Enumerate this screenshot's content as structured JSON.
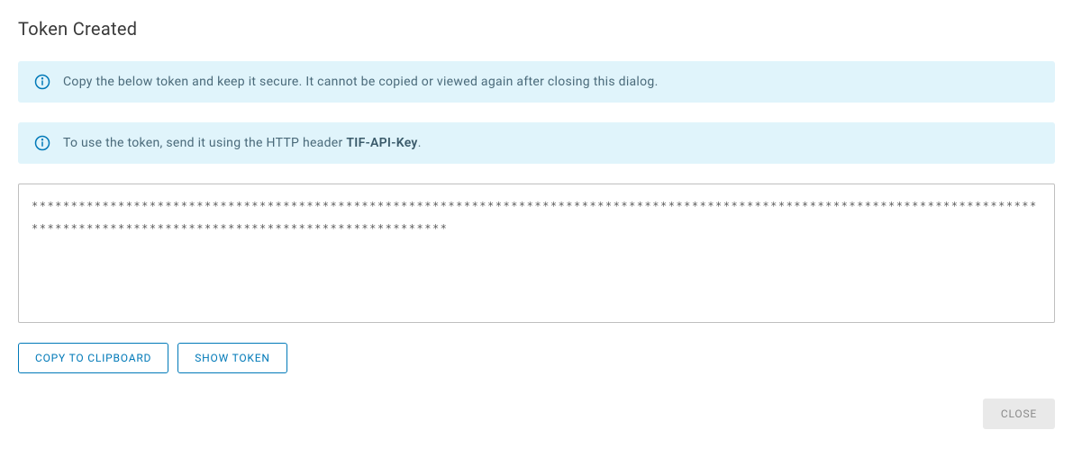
{
  "dialog": {
    "title": "Token Created"
  },
  "banners": {
    "secure_warning": "Copy the below token and keep it secure. It cannot be copied or viewed again after closing this dialog.",
    "usage_prefix": "To use the token, send it using the HTTP header ",
    "usage_header_name": "TIF-API-Key",
    "usage_suffix": "."
  },
  "token": {
    "masked_value": "*************************************************************************************************************************************************************************************"
  },
  "buttons": {
    "copy": "COPY TO CLIPBOARD",
    "show": "SHOW TOKEN",
    "close": "CLOSE"
  }
}
